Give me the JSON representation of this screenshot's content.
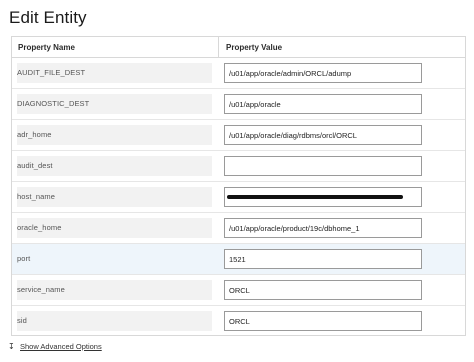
{
  "dialog": {
    "title": "Edit Entity"
  },
  "table": {
    "columns": [
      "Property Name",
      "Property Value"
    ],
    "rows": [
      {
        "name": "AUDIT_FILE_DEST",
        "value": "/u01/app/oracle/admin/ORCL/adump"
      },
      {
        "name": "DIAGNOSTIC_DEST",
        "value": "/u01/app/oracle"
      },
      {
        "name": "adr_home",
        "value": "/u01/app/oracle/diag/rdbms/orcl/ORCL"
      },
      {
        "name": "audit_dest",
        "value": ""
      },
      {
        "name": "host_name",
        "value": ""
      },
      {
        "name": "oracle_home",
        "value": "/u01/app/oracle/product/19c/dbhome_1"
      },
      {
        "name": "port",
        "value": "1521"
      },
      {
        "name": "service_name",
        "value": "ORCL"
      },
      {
        "name": "sid",
        "value": "ORCL"
      }
    ]
  },
  "footer": {
    "icon": "expand-arrow-icon",
    "link": "Show Advanced Options"
  }
}
